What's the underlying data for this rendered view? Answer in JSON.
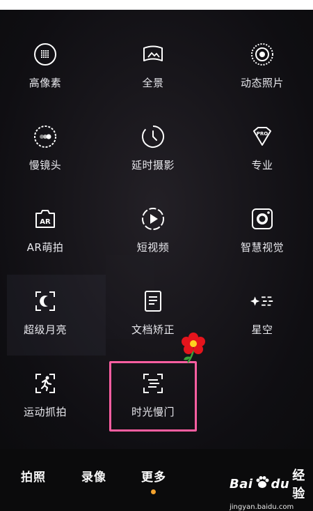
{
  "modes": [
    [
      {
        "label": "高像素",
        "icon": "high-pixel-icon"
      },
      {
        "label": "全景",
        "icon": "panorama-icon"
      },
      {
        "label": "动态照片",
        "icon": "moving-photo-icon"
      }
    ],
    [
      {
        "label": "慢镜头",
        "icon": "slow-motion-icon"
      },
      {
        "label": "延时摄影",
        "icon": "time-lapse-icon"
      },
      {
        "label": "专业",
        "icon": "pro-icon"
      }
    ],
    [
      {
        "label": "AR萌拍",
        "icon": "ar-lens-icon"
      },
      {
        "label": "短视频",
        "icon": "short-video-icon"
      },
      {
        "label": "智慧视觉",
        "icon": "ai-vision-icon"
      }
    ],
    [
      {
        "label": "超级月亮",
        "icon": "super-moon-icon"
      },
      {
        "label": "文档矫正",
        "icon": "document-correction-icon"
      },
      {
        "label": "星空",
        "icon": "starry-sky-icon"
      }
    ],
    [
      {
        "label": "运动抓拍",
        "icon": "sport-snapshot-icon"
      },
      {
        "label": "时光慢门",
        "icon": "light-painting-icon"
      }
    ]
  ],
  "bottom_tabs": [
    {
      "label": "拍照",
      "active": false
    },
    {
      "label": "录像",
      "active": false
    },
    {
      "label": "更多",
      "active": true
    }
  ],
  "accent_color": "#f4a32e",
  "highlight_color": "#ff5ea1",
  "watermark": {
    "brand_b": "Bai",
    "brand_d": "du",
    "brand_cn": "经验",
    "site": "jingyan.baidu.com"
  }
}
